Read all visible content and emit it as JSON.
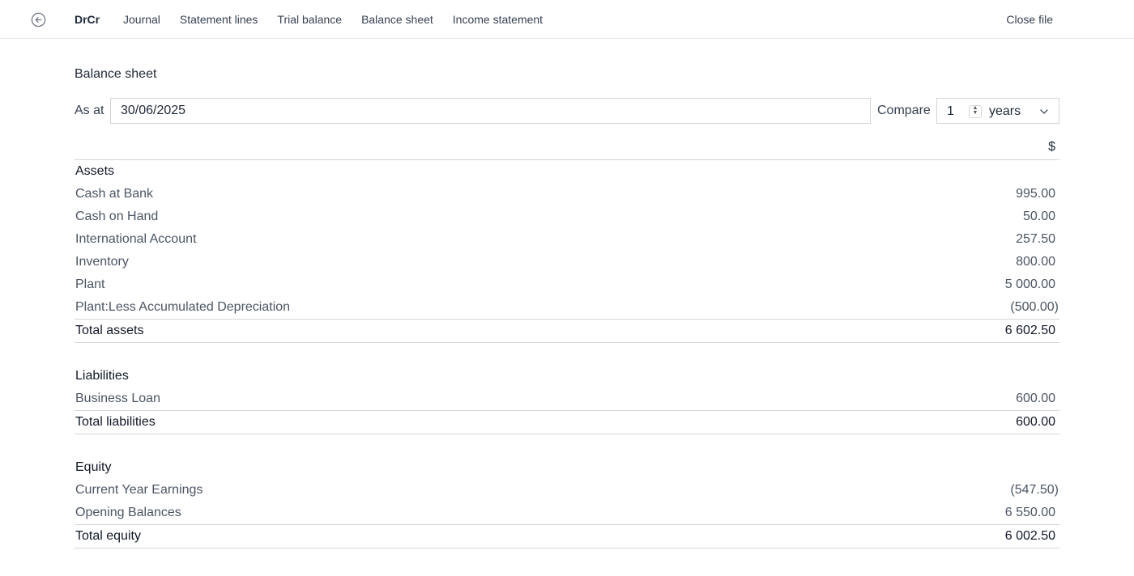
{
  "header": {
    "brand": "DrCr",
    "nav": [
      "Journal",
      "Statement lines",
      "Trial balance",
      "Balance sheet",
      "Income statement"
    ],
    "close_file": "Close file",
    "back_icon": "circle-arrow-left-icon"
  },
  "page": {
    "title": "Balance sheet",
    "as_at_label": "As at",
    "as_at_value": "30/06/2025",
    "compare_label": "Compare",
    "compare_value": "1",
    "compare_unit": "years"
  },
  "report": {
    "currency": "$",
    "sections": [
      {
        "heading": "Assets",
        "lines": [
          {
            "name": "Cash at Bank",
            "amount": "995.00"
          },
          {
            "name": "Cash on Hand",
            "amount": "50.00"
          },
          {
            "name": "International Account",
            "amount": "257.50"
          },
          {
            "name": "Inventory",
            "amount": "800.00"
          },
          {
            "name": "Plant",
            "amount": "5 000.00"
          },
          {
            "name": "Plant:Less Accumulated Depreciation",
            "amount": "(500.00)"
          }
        ],
        "total_label": "Total assets",
        "total_amount": "6 602.50"
      },
      {
        "heading": "Liabilities",
        "lines": [
          {
            "name": "Business Loan",
            "amount": "600.00"
          }
        ],
        "total_label": "Total liabilities",
        "total_amount": "600.00"
      },
      {
        "heading": "Equity",
        "lines": [
          {
            "name": "Current Year Earnings",
            "amount": "(547.50)"
          },
          {
            "name": "Opening Balances",
            "amount": "6 550.00"
          }
        ],
        "total_label": "Total equity",
        "total_amount": "6 002.50"
      }
    ]
  }
}
